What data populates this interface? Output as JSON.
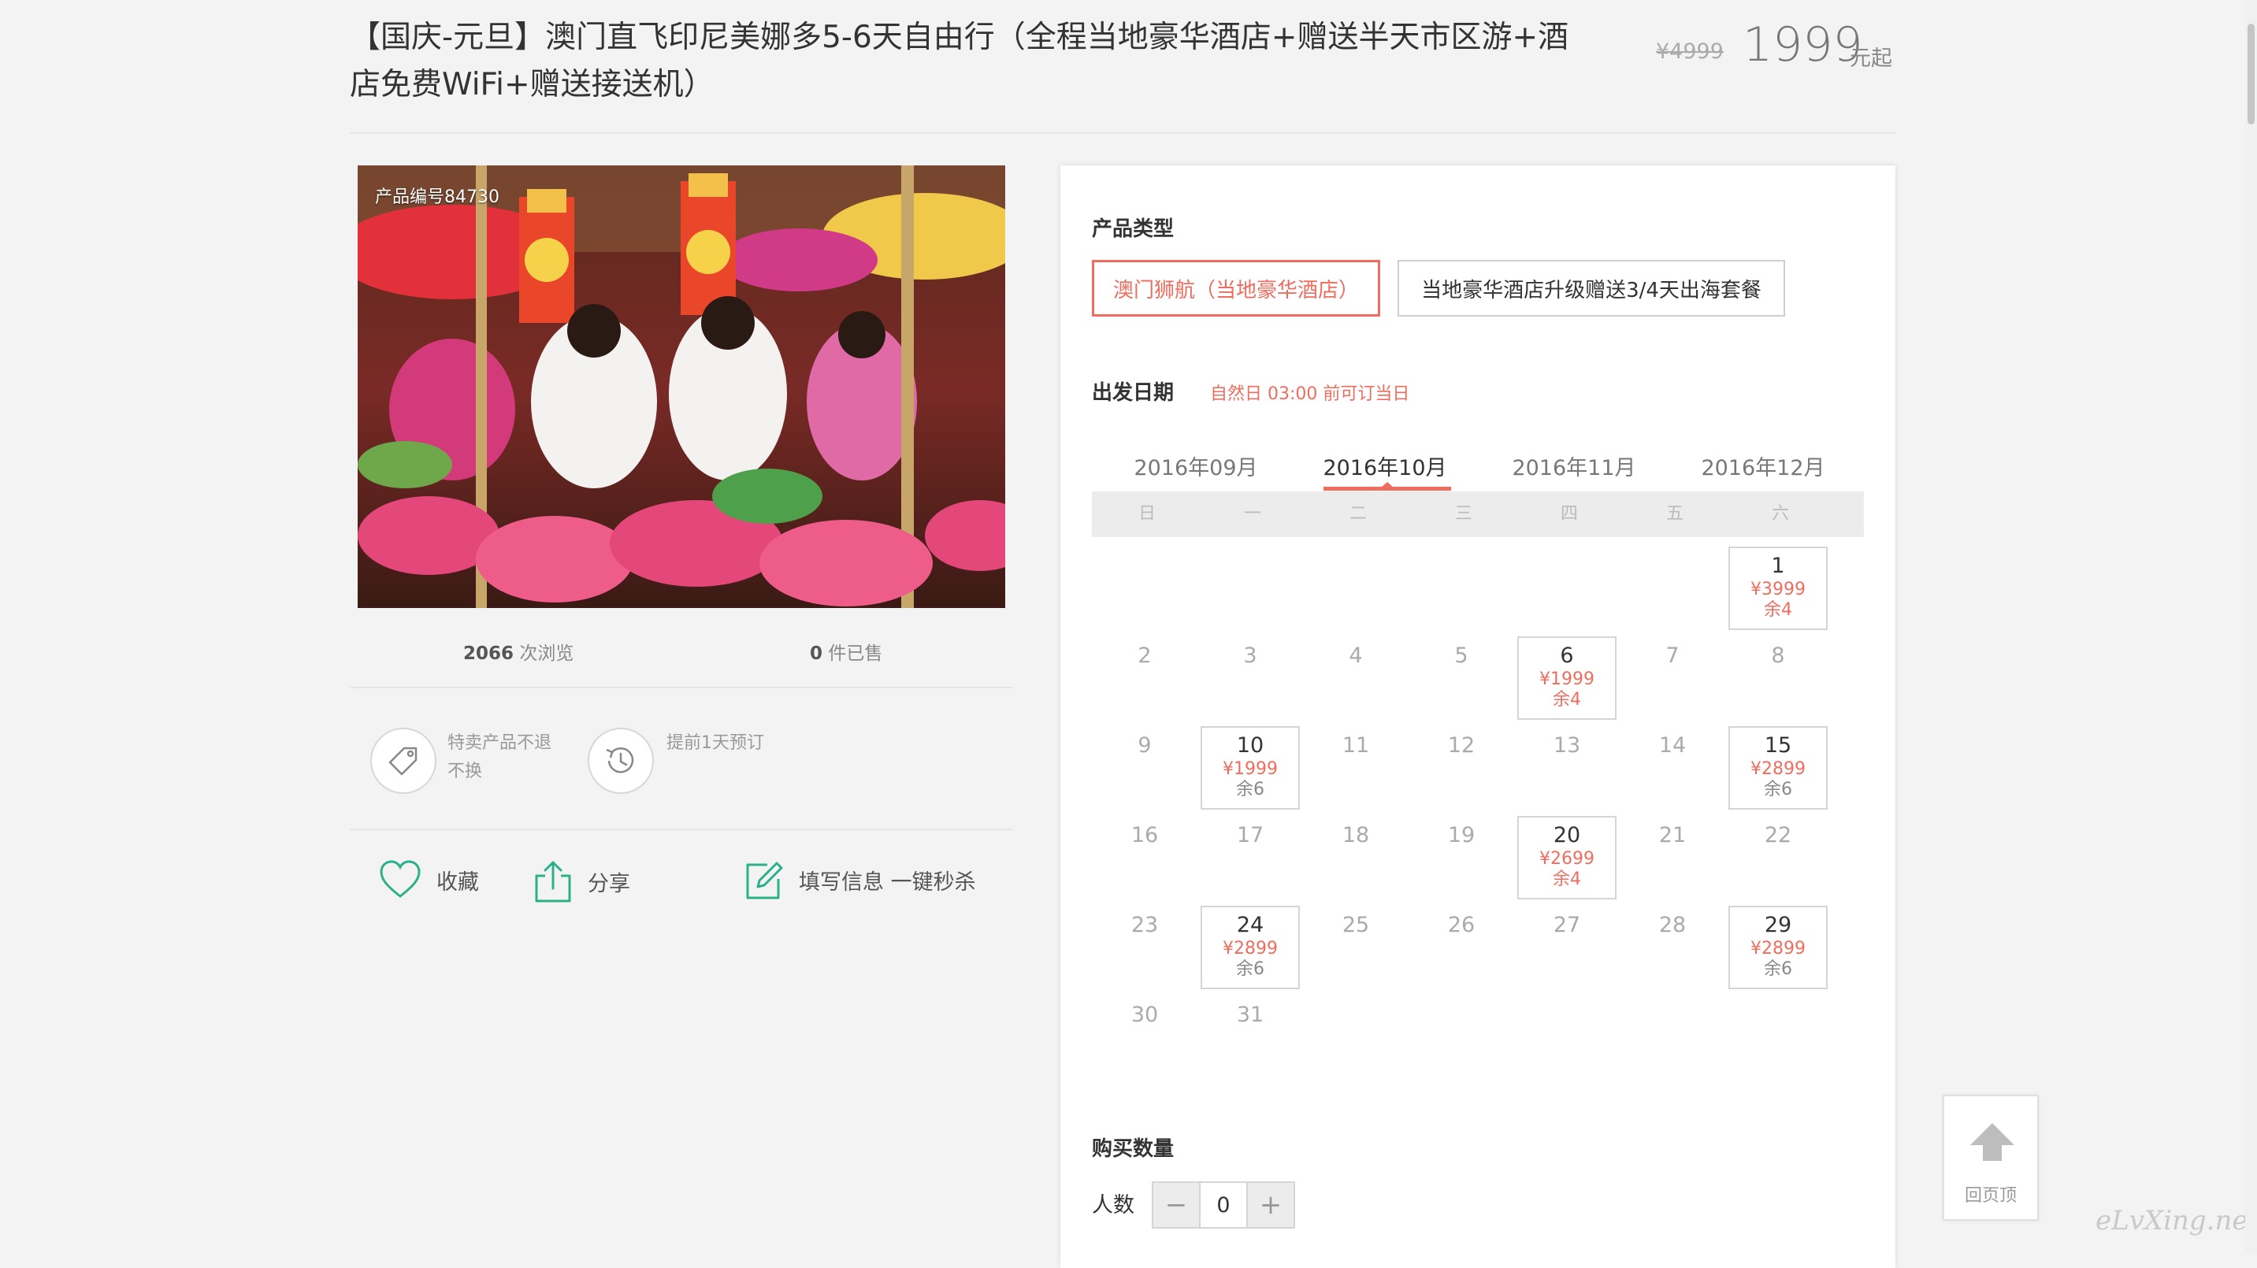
{
  "product": {
    "title": "【国庆-元旦】澳门直飞印尼美娜多5-6天自由行（全程当地豪华酒店+赠送半天市区游+酒店免费WiFi+赠送接送机）",
    "old_price": "¥4999",
    "price": "1999",
    "price_unit": "元起",
    "code": "产品编号84730"
  },
  "stats": {
    "views_count": "2066",
    "views_label": "次浏览",
    "sold_count": "0",
    "sold_label": "件已售"
  },
  "features": [
    {
      "icon": "tag-icon",
      "text": "特卖产品不退不换"
    },
    {
      "icon": "clock-history-icon",
      "text": "提前1天预订"
    }
  ],
  "actions": {
    "favorite": "收藏",
    "share": "分享",
    "fill": "填写信息 一键秒杀"
  },
  "booking": {
    "type_label": "产品类型",
    "types": [
      "澳门狮航（当地豪华酒店）",
      "当地豪华酒店升级赠送3/4天出海套餐"
    ],
    "selected_type": 0,
    "date_label": "出发日期",
    "date_note": "自然日 03:00 前可订当日",
    "months": [
      "2016年09月",
      "2016年10月",
      "2016年11月",
      "2016年12月"
    ],
    "selected_month": 1,
    "weekdays": [
      "日",
      "一",
      "二",
      "三",
      "四",
      "五",
      "六"
    ],
    "calendar_first_weekday": 6,
    "calendar_days": 31,
    "available_days": [
      {
        "day": 1,
        "price": "¥3999",
        "stock": "余4",
        "stock_red": true
      },
      {
        "day": 6,
        "price": "¥1999",
        "stock": "余4",
        "stock_red": true
      },
      {
        "day": 10,
        "price": "¥1999",
        "stock": "余6",
        "stock_red": false
      },
      {
        "day": 15,
        "price": "¥2899",
        "stock": "余6",
        "stock_red": false
      },
      {
        "day": 20,
        "price": "¥2699",
        "stock": "余4",
        "stock_red": true
      },
      {
        "day": 24,
        "price": "¥2899",
        "stock": "余6",
        "stock_red": false
      },
      {
        "day": 29,
        "price": "¥2899",
        "stock": "余6",
        "stock_red": false
      }
    ],
    "qty_label": "购买数量",
    "people_label": "人数",
    "qty_value": "0",
    "minus": "−",
    "plus": "+"
  },
  "back_to_top": "回页顶",
  "watermark": "eLvXing.net",
  "colors": {
    "accent": "#ef6d5e",
    "green": "#2bb08a"
  }
}
